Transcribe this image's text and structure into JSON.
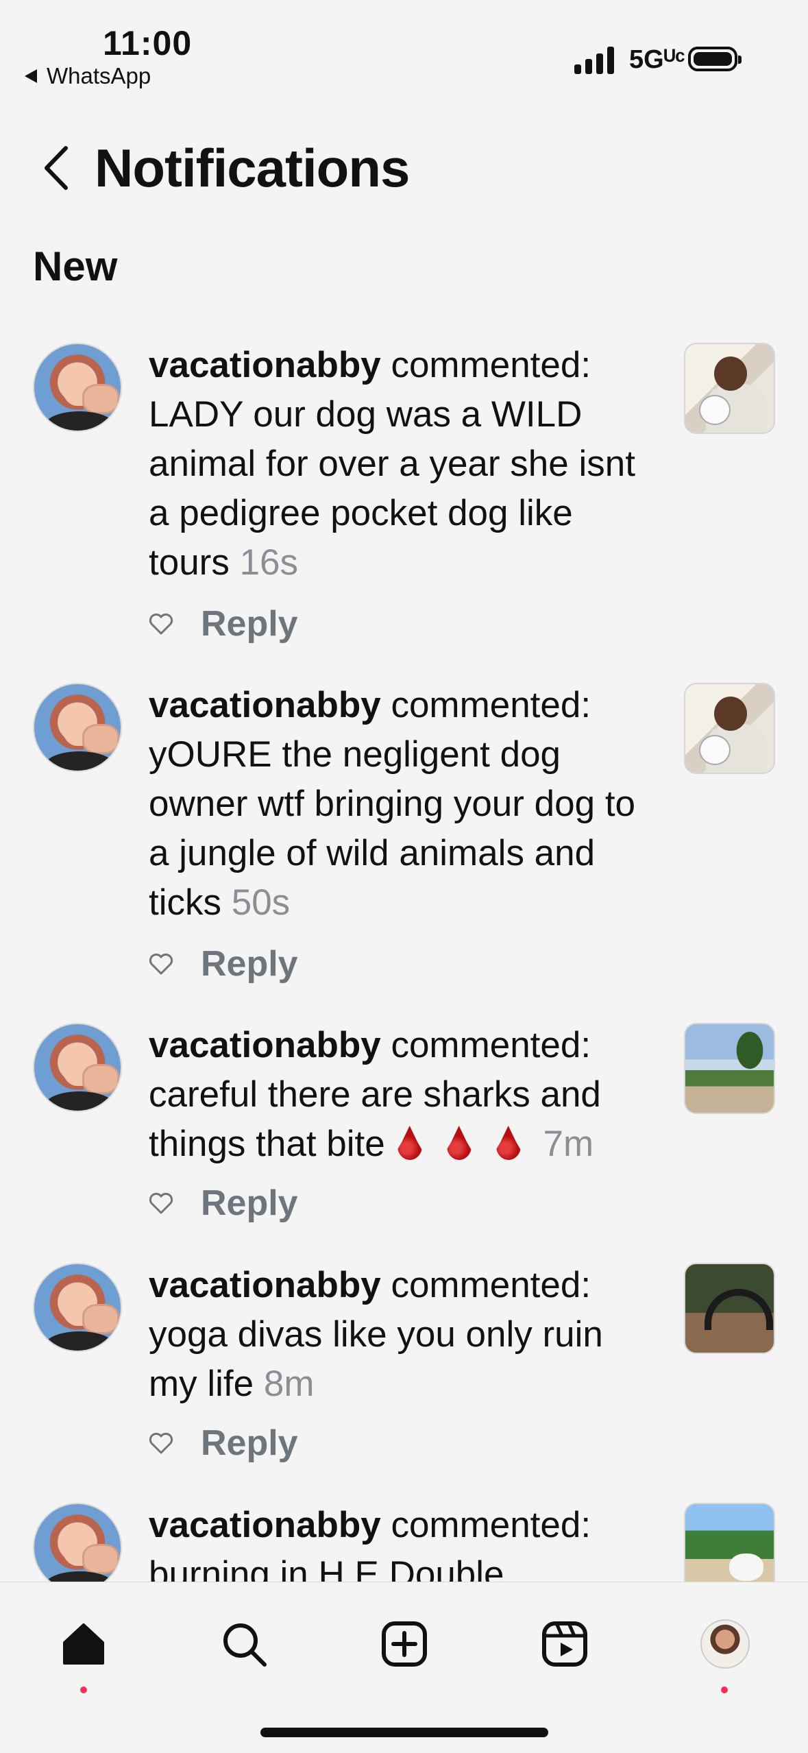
{
  "status_bar": {
    "time": "11:00",
    "back_app": "WhatsApp",
    "network": "5Gᵁᶜ"
  },
  "header": {
    "title": "Notifications"
  },
  "section_label": "New",
  "notifications": [
    {
      "username": "vacationabby",
      "action": " commented:",
      "comment": "LADY our dog was a WILD animal for over a year she isnt a pedigree pocket dog like tours",
      "time": "16s",
      "reply": "Reply",
      "thumb": "room"
    },
    {
      "username": "vacationabby",
      "action": " commented:",
      "comment": "yOURE the negligent dog owner wtf bringing your dog to a jungle of wild animals and ticks",
      "time": "50s",
      "reply": "Reply",
      "thumb": "room"
    },
    {
      "username": "vacationabby",
      "action": " commented:",
      "comment": "careful there are sharks and things that bite",
      "emoji": "blood-drop x3",
      "time": "7m",
      "reply": "Reply",
      "thumb": "beach"
    },
    {
      "username": "vacationabby",
      "action": " commented:",
      "comment": "yoga divas like you only ruin my life",
      "time": "8m",
      "reply": "Reply",
      "thumb": "yoga"
    },
    {
      "username": "vacationabby",
      "action": " commented:",
      "comment": "burning in H.E Double",
      "thumb": "tropic"
    }
  ],
  "tabbar": {
    "icons": [
      "home-icon",
      "search-icon",
      "create-icon",
      "reels-icon",
      "profile-avatar"
    ],
    "badge_color": "#ff2d55"
  }
}
